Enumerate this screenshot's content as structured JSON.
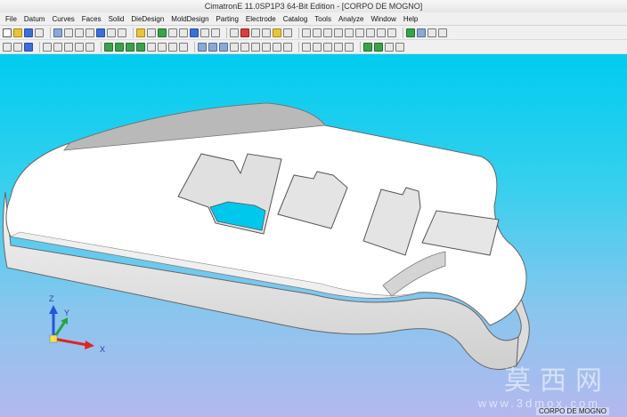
{
  "window": {
    "title": "CimatronE 11.0SP1P3 64-Bit Edition - [CORPO DE MOGNO]"
  },
  "menu": {
    "items": [
      "File",
      "Datum",
      "Curves",
      "Faces",
      "Solid",
      "DieDesign",
      "MoldDesign",
      "Parting",
      "Electrode",
      "Catalog",
      "Tools",
      "Analyze",
      "Window",
      "Help"
    ]
  },
  "viewport": {
    "background_top": "#00ccef",
    "background_bottom": "#b4b8ee",
    "model": "guitar-body-solid",
    "axes": {
      "x": "X",
      "y": "Y",
      "z": "Z"
    },
    "document_label": "CORPO DE MOGNO"
  },
  "watermark": {
    "text": "莫西网",
    "sub": "www.3dmox.com"
  },
  "colors": {
    "axis_x": "#e02424",
    "axis_y": "#22a544",
    "axis_z": "#2255dd"
  }
}
